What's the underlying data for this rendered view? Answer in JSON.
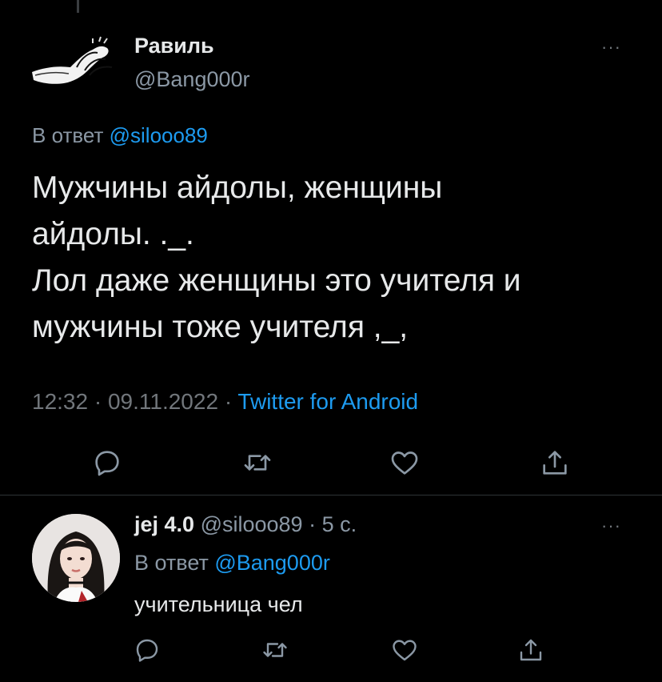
{
  "tweet": {
    "author_name": "Равиль",
    "author_handle": "@Bang000r",
    "replying_prefix": "В ответ",
    "replying_handle": "@silooo89",
    "body_lines": [
      "Мужчины айдолы, женщины",
      "айдолы. ._.",
      "Лол даже женщины это учителя и",
      "мужчины тоже учителя ,_,"
    ],
    "time": "12:32",
    "date": "09.11.2022",
    "source": "Twitter for Android",
    "more_label": "···"
  },
  "actions": {
    "icons": [
      "reply-icon",
      "retweet-icon",
      "like-icon",
      "share-icon"
    ]
  },
  "reply": {
    "author_name": "jej 4.0",
    "author_handle": "@silooo89",
    "time_ago": "5 с.",
    "replying_prefix": "В ответ",
    "replying_handle": "@Bang000r",
    "text": "учительница чел",
    "more_label": "···"
  },
  "colors": {
    "background": "#000000",
    "text": "#e7e9ea",
    "secondary": "#8b98a5",
    "accent": "#1d9bf0"
  }
}
